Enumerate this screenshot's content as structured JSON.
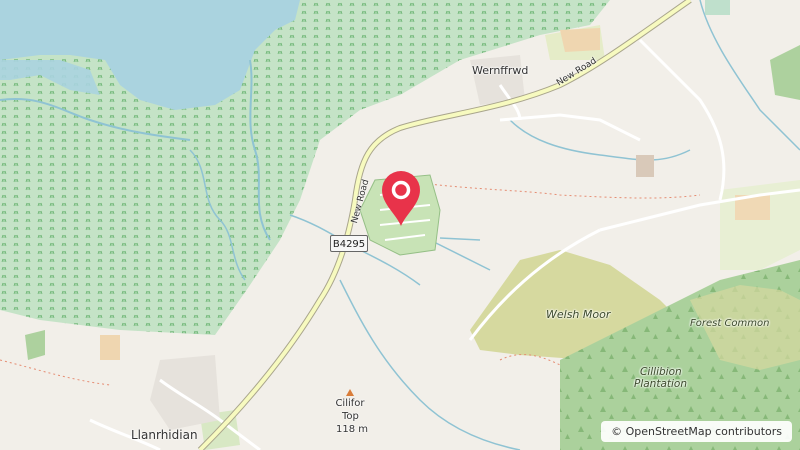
{
  "map": {
    "places": {
      "wernffrwd": "Wernffrwd",
      "llanrhidian": "Llanrhidian",
      "welsh_moor": "Welsh Moor",
      "forest_common": "Forest Common",
      "cillibion_plantation_line1": "Cillibion",
      "cillibion_plantation_line2": "Plantation"
    },
    "roads": {
      "new_road_east": "New Road",
      "new_road_west": "New Road",
      "b_road_ref": "B4295"
    },
    "peak": {
      "name_line1": "Cilifor",
      "name_line2": "Top",
      "elevation": "118 m"
    },
    "attribution": "© OpenStreetMap contributors",
    "colors": {
      "land": "#f2efe9",
      "water": "#aad3df",
      "marsh": "#c9e3c0",
      "wood": "#add19e",
      "heath": "#d6d99f",
      "road_major": "#f7fabf",
      "marker": "#e8334a"
    },
    "marker_icon": "map-pin-icon"
  }
}
